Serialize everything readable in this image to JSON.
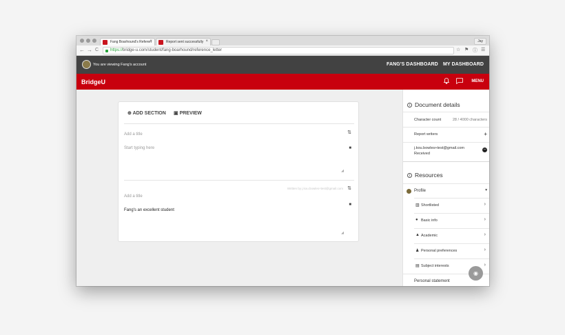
{
  "browser": {
    "tabs": [
      {
        "title": "Fang Boarhound's Referen",
        "close": "×"
      },
      {
        "title": "Report sent successfully",
        "close": "×"
      }
    ],
    "user_chip": "Jay",
    "url_scheme": "https://",
    "url_rest": "bridge-u.com/student/fang-boarhound/reference_letter",
    "nav": {
      "back": "←",
      "forward": "→",
      "reload": "C"
    },
    "icons": {
      "star": "☆",
      "extension": "⚑",
      "info": "ⓘ",
      "menu": "☰"
    }
  },
  "darkbar": {
    "viewing_text": "You are viewing Fang's account",
    "nav": [
      "FANG'S DASHBOARD",
      "MY DASHBOARD"
    ]
  },
  "redbar": {
    "logo": "BridgeU",
    "bell_icon": "♫",
    "chat_icon": "▭",
    "menu_label": "MENU"
  },
  "editor": {
    "add_section": "ADD SECTION",
    "preview": "PREVIEW",
    "add_icon": "⊕",
    "preview_icon": "▣",
    "sections": [
      {
        "title_placeholder": "Add a title",
        "body_placeholder": "Start typing here",
        "body": ""
      },
      {
        "written_by": "Written by j.kou.bowles+test@gmail.com",
        "title_placeholder": "Add a title",
        "body": "Fang's an excellent student"
      }
    ],
    "reorder_icon": "⇅",
    "delete_icon": "■",
    "resize_icon": "◢"
  },
  "panel": {
    "document_details": "Document details",
    "character_count_label": "Character count",
    "character_count_value": "28 / 4000 characters",
    "report_writers_label": "Report writers",
    "writer_email": "j.kou.bowles+test@gmail.com",
    "writer_status": "Received",
    "resources": "Resources",
    "profile": "Profile",
    "profile_items": [
      {
        "icon": "▥",
        "label": "Shortlisted"
      },
      {
        "icon": "●",
        "label": "Basic info"
      },
      {
        "icon": "▲",
        "label": "Academic"
      },
      {
        "icon": "♟",
        "label": "Personal preferences"
      },
      {
        "icon": "▤",
        "label": "Subject interests"
      }
    ],
    "personal_statement": "Personal statement",
    "chevron": "›",
    "caret": "▾",
    "add_writer_icon": "+",
    "remove_icon": "–"
  },
  "chat_fab_icon": "◉"
}
